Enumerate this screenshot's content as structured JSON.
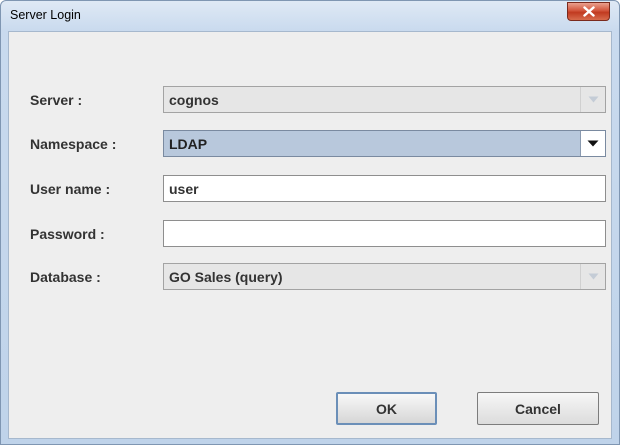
{
  "window": {
    "title": "Server Login"
  },
  "form": {
    "server": {
      "label": "Server :",
      "value": "cognos"
    },
    "namespace": {
      "label": "Namespace :",
      "value": "LDAP"
    },
    "username": {
      "label": "User name :",
      "value": "user"
    },
    "password": {
      "label": "Password :",
      "value": ""
    },
    "database": {
      "label": "Database :",
      "value": "GO Sales (query)"
    }
  },
  "buttons": {
    "ok_label": "OK",
    "cancel_label": "Cancel"
  },
  "icons": {
    "close": "close-icon",
    "dropdown": "chevron-down-icon"
  },
  "colors": {
    "close_button": "#c13a20",
    "titlebar": "#c9daee",
    "client_background": "#eeeeee",
    "selected_combo": "#b8c8dc"
  }
}
